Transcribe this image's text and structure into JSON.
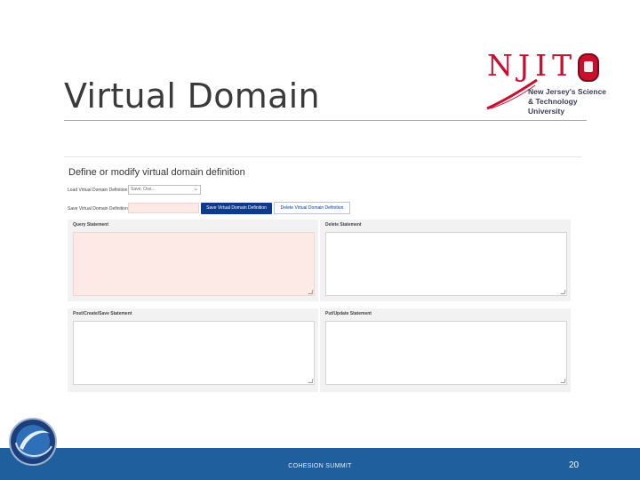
{
  "slide": {
    "title": "Virtual Domain",
    "footer": "COHESION SUMMIT",
    "page_number": "20"
  },
  "logo": {
    "letters": "NJIT",
    "subtitle": "New Jersey's Science & Technology University",
    "icons": [
      "njit-seal-icon",
      "njit-swoosh-icon",
      "cohesion-globe-icon"
    ]
  },
  "app": {
    "heading": "Define or modify virtual domain definition",
    "load_label": "Load Virtual Domain Definition",
    "load_select_value": "Save, Oos...",
    "save_label": "Save Virtual Domain Definition",
    "name_input_value": "",
    "save_button": "Save Virtual Domain Definition",
    "delete_button": "Delete Virtual Domain Definition",
    "panes": [
      {
        "label": "Query Statement",
        "value": ""
      },
      {
        "label": "Delete Statement",
        "value": ""
      },
      {
        "label": "Post/Create/Save Statement",
        "value": ""
      },
      {
        "label": "Put/Update Statement",
        "value": ""
      }
    ]
  },
  "colors": {
    "footer": "#1f5f9e",
    "primary_button": "#0d3a8a",
    "required_field": "#fde9e6",
    "brand_red": "#c8102e"
  }
}
